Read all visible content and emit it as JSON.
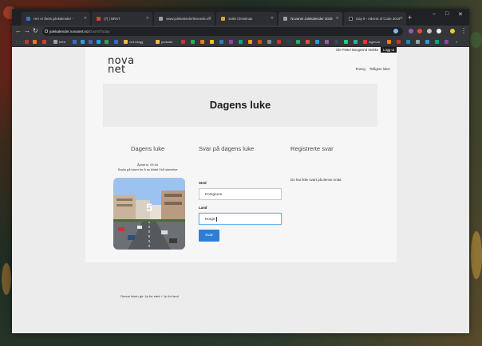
{
  "browser": {
    "tabs": [
      {
        "label": "Her er årets julekalender - ",
        "color": "#3c6fd6"
      },
      {
        "label": "(7) | NRST",
        "color": "#e1412b"
      },
      {
        "label": "www.julekalenderlieneeds.no",
        "color": "#9aa0a6"
      },
      {
        "label": "Sokk Christmas",
        "color": "#d9a23b"
      },
      {
        "label": "Novanet Julekalender 2019",
        "color": "#9aa0a6"
      },
      {
        "label": "Day 5 - Advent of Code 2019",
        "color": "#111111"
      }
    ],
    "url_host": "julekalender.novanet.no",
    "url_path": "/Doors/Today",
    "bookmarks": [
      {
        "label": "Infra",
        "color": "#9aa0a6"
      },
      {
        "label": "",
        "color": "#2f6fd1"
      },
      {
        "label": "",
        "color": "#2d9be1"
      },
      {
        "label": "",
        "color": "#4267b2"
      },
      {
        "label": "",
        "color": "#1da1f2"
      },
      {
        "label": "vz4-blogg",
        "color": "#f6b93b"
      },
      {
        "label": "podcast",
        "color": "#f6b93b"
      },
      {
        "label": "Agenda",
        "color": "#e33"
      }
    ]
  },
  "site": {
    "logo_line1": "nova",
    "logo_line2": "net",
    "user_name": "Ole Petter Bougesnd Stokka",
    "logout_label": "Logg ut",
    "menu": [
      "Poeng",
      "Tidligere luker"
    ],
    "hero_title": "Dagens luke"
  },
  "door": {
    "heading": "Dagens luke",
    "opened": "Åpnet kl. 09:34",
    "hint": "Svykk på luken for å se bildet i full størrelse",
    "number": "5",
    "caption": "Denne luken gir: 1p for sted + 1p for land"
  },
  "answer": {
    "heading": "Svar på dagens luke",
    "place_label": "Sted",
    "place_value": "Porsgrunn",
    "country_label": "Land",
    "country_value": "Norge",
    "submit_label": "Svar"
  },
  "registered": {
    "heading": "Registrerte svar",
    "empty_text": "Du har ikke svart på denne enda"
  },
  "colors": {
    "accent": "#2d7fd6",
    "focus": "#69b5f2",
    "chrome_dark": "#202124"
  }
}
